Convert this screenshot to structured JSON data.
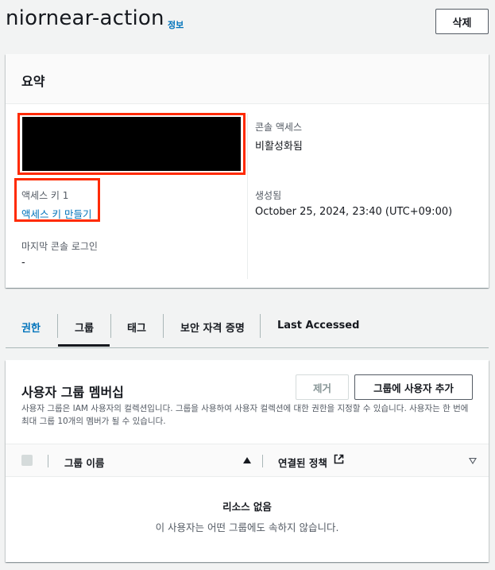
{
  "header": {
    "title": "niornear-action",
    "info_label": "정보",
    "delete_label": "삭제"
  },
  "summary": {
    "title": "요약",
    "access_key_label": "액세스 키 1",
    "create_access_key_link": "액세스 키 만들기",
    "last_console_login_label": "마지막 콘솔 로그인",
    "last_console_login_value": "-",
    "console_access_label": "콘솔 액세스",
    "console_access_value": "비활성화됨",
    "created_label": "생성됨",
    "created_value": "October 25, 2024, 23:40 (UTC+09:00)"
  },
  "tabs": [
    {
      "label": "권한",
      "active": false
    },
    {
      "label": "그룹",
      "active": true
    },
    {
      "label": "태그",
      "active": false
    },
    {
      "label": "보안 자격 증명",
      "active": false
    },
    {
      "label": "Last Accessed",
      "active": false
    }
  ],
  "groups": {
    "title": "사용자 그룹 멤버십",
    "description": "사용자 그룹은 IAM 사용자의 컬렉션입니다. 그룹을 사용하여 사용자 컬렉션에 대한 권한을 지정할 수 있습니다. 사용자는 한 번에 최대 그룹 10개의 멤버가 될 수 있습니다.",
    "remove_label": "제거",
    "add_label": "그룹에 사용자 추가",
    "columns": [
      "그룹 이름",
      "연결된 정책"
    ],
    "empty_title": "리소스 없음",
    "empty_desc": "이 사용자는 어떤 그룹에도 속하지 않습니다."
  },
  "colors": {
    "link": "#0073bb",
    "annotation_red": "#ff2a00",
    "text": "#16191f"
  }
}
